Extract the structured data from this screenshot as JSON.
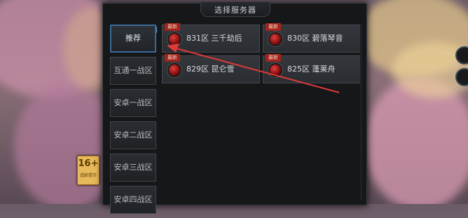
{
  "panel": {
    "title": "选择服务器"
  },
  "sidebar": {
    "items": [
      {
        "label": "推荐"
      },
      {
        "label": "互通一战区"
      },
      {
        "label": "安卓一战区"
      },
      {
        "label": "安卓二战区"
      },
      {
        "label": "安卓三战区"
      },
      {
        "label": "安卓四战区"
      }
    ]
  },
  "servers": [
    {
      "badge": "最新",
      "label": "831区  三千劫后"
    },
    {
      "badge": "最新",
      "label": "830区  碧落琴音"
    },
    {
      "badge": "最新",
      "label": "829区  昆仑雪"
    },
    {
      "badge": "最新",
      "label": "825区  蓬莱舟"
    }
  ],
  "age_badge": {
    "number": "16+",
    "subtext": "适龄提示"
  },
  "colors": {
    "accent": "#3b6a9a",
    "badge": "#a2241a",
    "annotation": "#e03a3a"
  }
}
